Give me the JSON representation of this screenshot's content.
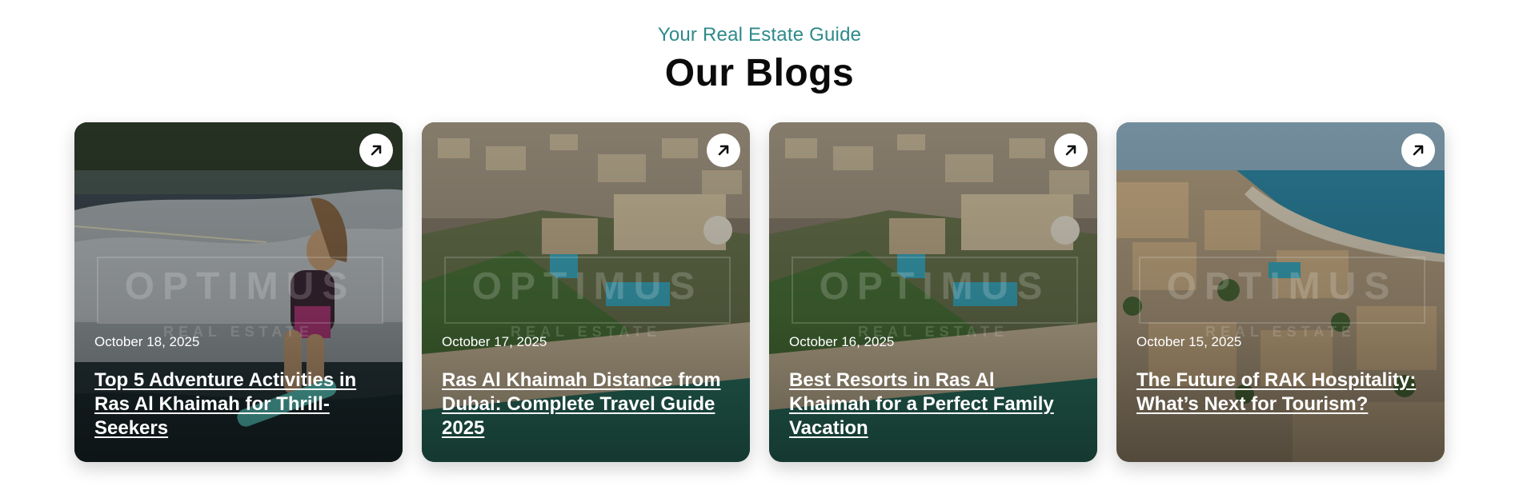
{
  "header": {
    "subtitle": "Your Real Estate Guide",
    "title": "Our Blogs"
  },
  "watermark": {
    "main": "OPTIMUS",
    "sub": "REAL ESTATE"
  },
  "cards": [
    {
      "date": "October 18, 2025",
      "title": "Top 5 Adventure Activities in Ras Al Khaimah for Thrill-Seekers",
      "icon": "arrow-up-right-icon"
    },
    {
      "date": "October 17, 2025",
      "title": "Ras Al Khaimah Distance from Dubai: Complete Travel Guide 2025",
      "icon": "arrow-up-right-icon"
    },
    {
      "date": "October 16, 2025",
      "title": "Best Resorts in Ras Al Khaimah for a Perfect Family Vacation",
      "icon": "arrow-up-right-icon"
    },
    {
      "date": "October 15, 2025",
      "title": "The Future of RAK Hospitality: What’s Next for Tourism?",
      "icon": "arrow-up-right-icon"
    }
  ],
  "colors": {
    "accent": "#2e8a8a",
    "title": "#0b0b0b"
  }
}
